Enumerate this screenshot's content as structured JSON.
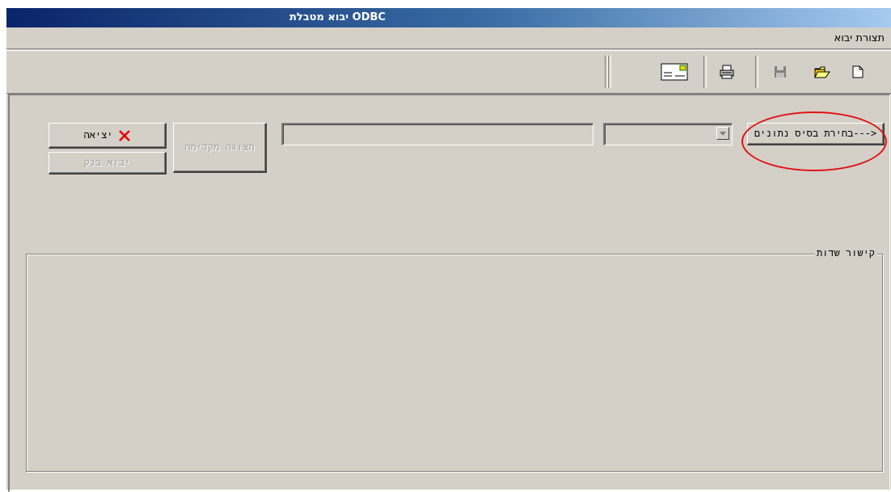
{
  "window": {
    "title": "יבוא מטבלת ODBC"
  },
  "menu": {
    "items": [
      {
        "label": "תצורת יבוא"
      }
    ]
  },
  "toolbar": {
    "buttons": [
      {
        "icon": "new-document-icon"
      },
      {
        "icon": "open-folder-icon"
      },
      {
        "icon": "save-disk-icon"
      },
      {
        "icon": "printer-icon"
      },
      {
        "icon": "mail-envelope-icon"
      }
    ]
  },
  "form": {
    "select_db_button": "בחירת בסיס נתונים--->",
    "db_combo_value": "",
    "db_path_value": "",
    "preview_button": "תצוגה מקדימה",
    "exit_button": "יציאה",
    "import_bank_button": "יבוא בנק",
    "fields_group_label": "קישור שדות"
  },
  "colors": {
    "highlight": "#e01010",
    "exit_icon": "#e00000"
  }
}
